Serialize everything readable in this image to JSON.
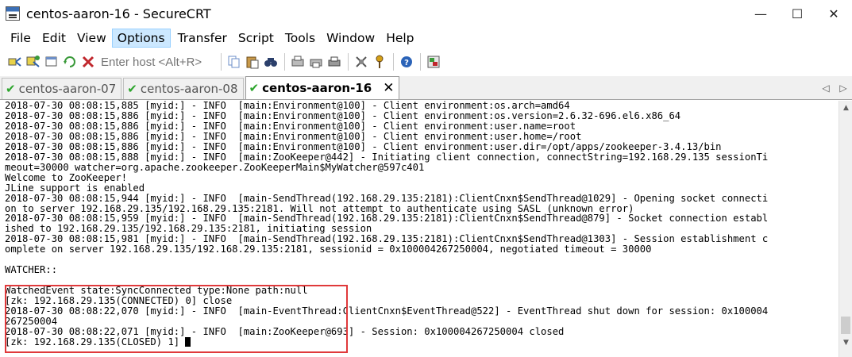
{
  "window": {
    "title": "centos-aaron-16 - SecureCRT",
    "controls": {
      "minimize": "—",
      "maximize": "☐",
      "close": "✕"
    }
  },
  "menu": [
    "File",
    "Edit",
    "View",
    "Options",
    "Transfer",
    "Script",
    "Tools",
    "Window",
    "Help"
  ],
  "menu_active": "Options",
  "toolbar": {
    "icons_left": [
      "connect-icon",
      "quick-connect-icon",
      "connect-tab-icon",
      "reconnect-icon",
      "disconnect-icon"
    ],
    "host_placeholder": "Enter host <Alt+R>",
    "icons_right": [
      "copy-icon",
      "paste-icon",
      "find-icon",
      "print-setup-icon",
      "print-selection-icon",
      "print-icon",
      "session-options-icon",
      "keymap-icon",
      "help-icon",
      "sftp-icon"
    ]
  },
  "tabs": [
    {
      "label": "centos-aaron-07",
      "active": false
    },
    {
      "label": "centos-aaron-08",
      "active": false
    },
    {
      "label": "centos-aaron-16",
      "active": true
    }
  ],
  "tab_close": "✕",
  "terminal": {
    "lines": [
      "2018-07-30 08:08:15,885 [myid:] - INFO  [main:Environment@100] - Client environment:os.arch=amd64",
      "2018-07-30 08:08:15,886 [myid:] - INFO  [main:Environment@100] - Client environment:os.version=2.6.32-696.el6.x86_64",
      "2018-07-30 08:08:15,886 [myid:] - INFO  [main:Environment@100] - Client environment:user.name=root",
      "2018-07-30 08:08:15,886 [myid:] - INFO  [main:Environment@100] - Client environment:user.home=/root",
      "2018-07-30 08:08:15,886 [myid:] - INFO  [main:Environment@100] - Client environment:user.dir=/opt/apps/zookeeper-3.4.13/bin",
      "2018-07-30 08:08:15,888 [myid:] - INFO  [main:ZooKeeper@442] - Initiating client connection, connectString=192.168.29.135 sessionTi",
      "meout=30000 watcher=org.apache.zookeeper.ZooKeeperMain$MyWatcher@597c401",
      "Welcome to ZooKeeper!",
      "JLine support is enabled",
      "2018-07-30 08:08:15,944 [myid:] - INFO  [main-SendThread(192.168.29.135:2181):ClientCnxn$SendThread@1029] - Opening socket connecti",
      "on to server 192.168.29.135/192.168.29.135:2181. Will not attempt to authenticate using SASL (unknown error)",
      "2018-07-30 08:08:15,959 [myid:] - INFO  [main-SendThread(192.168.29.135:2181):ClientCnxn$SendThread@879] - Socket connection establ",
      "ished to 192.168.29.135/192.168.29.135:2181, initiating session",
      "2018-07-30 08:08:15,981 [myid:] - INFO  [main-SendThread(192.168.29.135:2181):ClientCnxn$SendThread@1303] - Session establishment c",
      "omplete on server 192.168.29.135/192.168.29.135:2181, sessionid = 0x100004267250004, negotiated timeout = 30000",
      "",
      "WATCHER::",
      "",
      "WatchedEvent state:SyncConnected type:None path:null",
      "[zk: 192.168.29.135(CONNECTED) 0] close",
      "2018-07-30 08:08:22,070 [myid:] - INFO  [main-EventThread:ClientCnxn$EventThread@522] - EventThread shut down for session: 0x100004",
      "267250004",
      "2018-07-30 08:08:22,071 [myid:] - INFO  [main:ZooKeeper@693] - Session: 0x100004267250004 closed",
      "[zk: 192.168.29.135(CLOSED) 1] "
    ]
  },
  "colors": {
    "highlight_box": "#e0393b",
    "menu_active_bg": "#cce8ff",
    "tab_check": "#2da52d"
  }
}
